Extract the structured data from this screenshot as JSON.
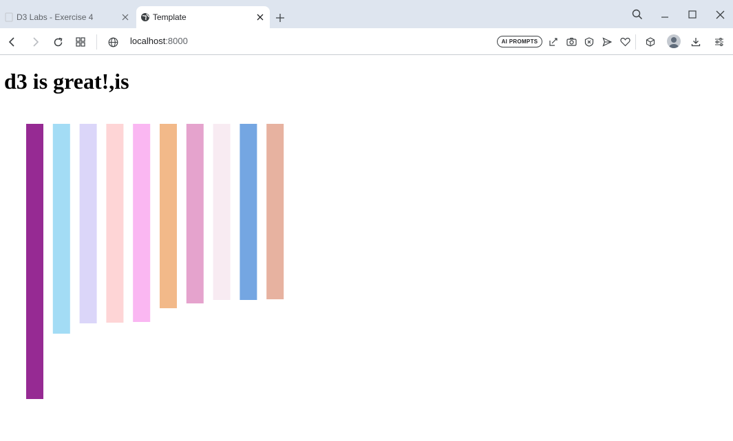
{
  "browser": {
    "tabs": [
      {
        "title": "D3 Labs - Exercise 4",
        "active": false
      },
      {
        "title": "Template",
        "active": true
      }
    ],
    "address": {
      "host": "localhost",
      "port": ":8000"
    },
    "ai_badge": "AI PROMPTS"
  },
  "page": {
    "heading": "d3 is great!,is"
  },
  "chart_data": {
    "type": "bar",
    "title": "",
    "xlabel": "",
    "ylabel": "",
    "values": [
      400,
      305,
      290,
      289,
      288,
      268,
      261,
      256,
      256,
      255
    ],
    "colors": [
      "#962a93",
      "#a3dcf5",
      "#dbd6f9",
      "#fed5d6",
      "#fab7f2",
      "#f2b989",
      "#e5a3cd",
      "#f8ebf2",
      "#74a6e2",
      "#e7b2a0"
    ],
    "ylim": [
      0,
      400
    ],
    "grid": false,
    "legend": "none"
  }
}
